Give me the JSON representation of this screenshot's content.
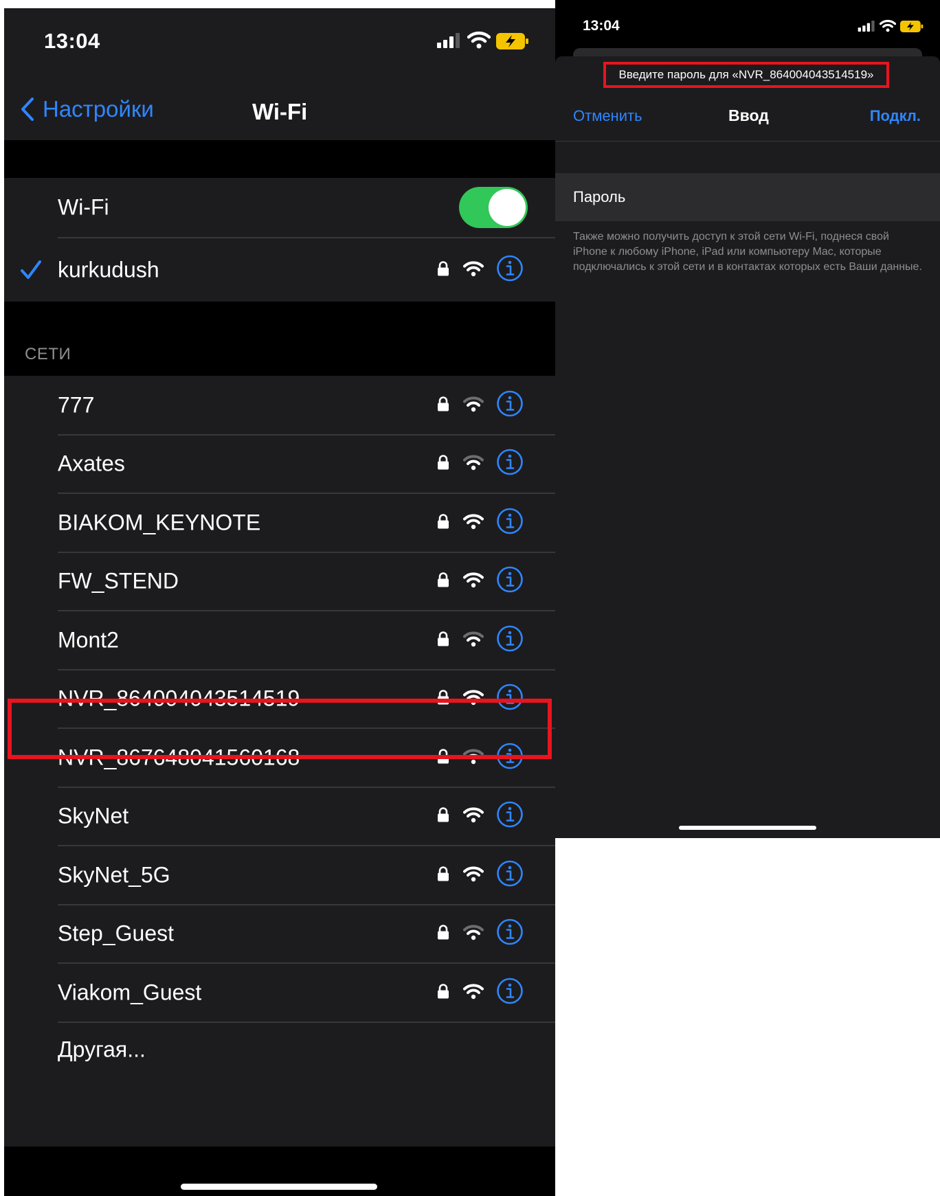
{
  "left_screen": {
    "status": {
      "time": "13:04"
    },
    "nav": {
      "back_label": "Настройки",
      "title": "Wi-Fi"
    },
    "wifi_toggle": {
      "label": "Wi-Fi",
      "on": true
    },
    "connected": {
      "name": "kurkudush",
      "locked": true,
      "signal_bars": 3
    },
    "section_header": "СЕТИ",
    "networks": [
      {
        "name": "777",
        "locked": true,
        "signal_bars": 2
      },
      {
        "name": "Axates",
        "locked": true,
        "signal_bars": 2
      },
      {
        "name": "BIAKOM_KEYNOTE",
        "locked": true,
        "signal_bars": 3
      },
      {
        "name": "FW_STEND",
        "locked": true,
        "signal_bars": 3
      },
      {
        "name": "Mont2",
        "locked": true,
        "signal_bars": 2
      },
      {
        "name": "NVR_864004043514519",
        "locked": true,
        "signal_bars": 3,
        "highlighted": true
      },
      {
        "name": "NVR_867648041560168",
        "locked": true,
        "signal_bars": 2
      },
      {
        "name": "SkyNet",
        "locked": true,
        "signal_bars": 3
      },
      {
        "name": "SkyNet_5G",
        "locked": true,
        "signal_bars": 3
      },
      {
        "name": "Step_Guest",
        "locked": true,
        "signal_bars": 2
      },
      {
        "name": "Viakom_Guest",
        "locked": true,
        "signal_bars": 3
      }
    ],
    "other_label": "Другая..."
  },
  "right_screen": {
    "status": {
      "time": "13:04"
    },
    "prompt": "Введите пароль для «NVR_864004043514519»",
    "cancel_label": "Отменить",
    "title": "Ввод",
    "join_label": "Подкл.",
    "password_label": "Пароль",
    "password_value": "",
    "hint": "Также можно получить доступ к этой сети Wi-Fi, поднеся свой iPhone к любому iPhone, iPad или компьютеру Mac, которые подключались к этой сети и в контактах которых есть Ваши данные."
  },
  "colors": {
    "accent": "#2f86ff",
    "toggle_on": "#32c759",
    "highlight": "#e8141e",
    "battery": "#f5c400"
  }
}
